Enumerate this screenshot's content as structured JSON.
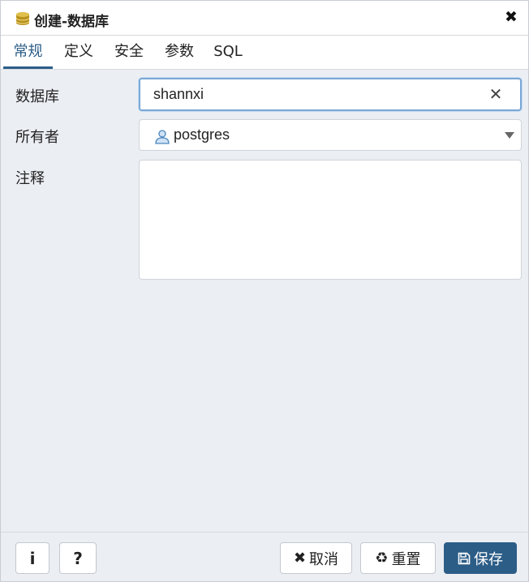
{
  "dialog": {
    "title": "创建-数据库",
    "close_glyph": "✖",
    "icon": "database-icon"
  },
  "tabs": [
    {
      "label": "常规",
      "active": true
    },
    {
      "label": "定义",
      "active": false
    },
    {
      "label": "安全",
      "active": false
    },
    {
      "label": "参数",
      "active": false
    },
    {
      "label": "SQL",
      "active": false
    }
  ],
  "form": {
    "database": {
      "label": "数据库",
      "value": "shannxi",
      "clear_glyph": "✕"
    },
    "owner": {
      "label": "所有者",
      "value": "postgres",
      "icon": "user-icon"
    },
    "comment": {
      "label": "注释",
      "value": ""
    }
  },
  "footer": {
    "info_glyph": "i",
    "help_glyph": "?",
    "cancel": {
      "icon_glyph": "✖",
      "label": "取消"
    },
    "reset": {
      "icon_glyph": "♻",
      "label": "重置"
    },
    "save": {
      "label": "保存"
    }
  },
  "colors": {
    "accent": "#2c5d87",
    "panel_bg": "#ebeef3",
    "focus_border": "#7aa8d6"
  }
}
